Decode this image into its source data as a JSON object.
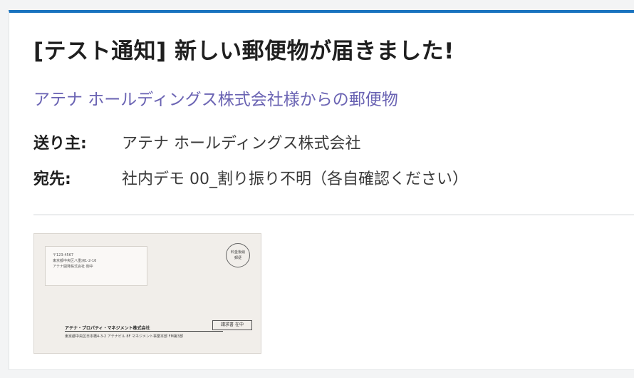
{
  "notification": {
    "title": "[テスト通知] 新しい郵便物が届きました!",
    "subtitle": "アテナ ホールディングス株式会社様からの郵便物",
    "sender_label": "送り主:",
    "sender_value": "アテナ ホールディングス株式会社",
    "recipient_label": "宛先:",
    "recipient_value": "社内デモ 00_割り振り不明（各自確認ください）",
    "accent_color": "#1a73bf",
    "subtitle_color": "#6a63b3"
  },
  "envelope": {
    "postal_code": "〒123-4567",
    "recipient_address": "東京都中央区八重洲1-2-16",
    "recipient_company": "アテナ開発株式会社 御中",
    "stamp_line1": "料金後納",
    "stamp_line2": "郵便",
    "doc_type": "請求書 在中",
    "sender_company": "アテナ・プロパティ・マネジメント株式会社",
    "sender_address": "東京都中央区日本橋4-3-2 アテナビル 8F マネジメント事業本部 FM第3部"
  }
}
